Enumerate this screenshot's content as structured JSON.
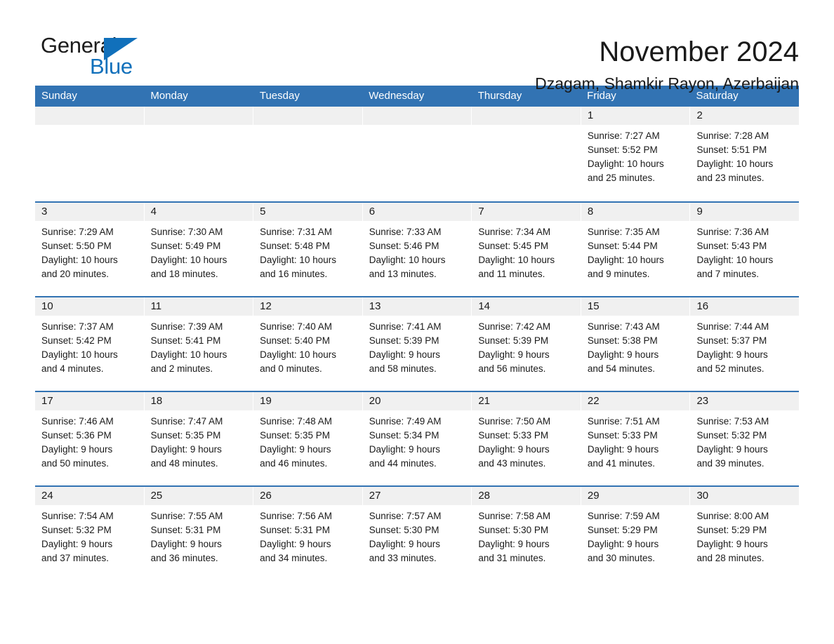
{
  "logo": {
    "word_general": "General",
    "word_blue": "Blue",
    "triangle_color": "#1170bb"
  },
  "header": {
    "title": "November 2024",
    "subtitle": "Dzagam, Shamkir Rayon, Azerbaijan"
  },
  "theme": {
    "accent": "#3273b3",
    "daynum_bg": "#f0f0f0",
    "text": "#1a1a1a",
    "header_text": "#ffffff"
  },
  "weekdays": [
    "Sunday",
    "Monday",
    "Tuesday",
    "Wednesday",
    "Thursday",
    "Friday",
    "Saturday"
  ],
  "labels": {
    "sunrise_prefix": "Sunrise:",
    "sunset_prefix": "Sunset:",
    "daylight_prefix": "Daylight:"
  },
  "weeks": [
    [
      {
        "empty": true
      },
      {
        "empty": true
      },
      {
        "empty": true
      },
      {
        "empty": true
      },
      {
        "empty": true
      },
      {
        "day": "1",
        "sunrise": "Sunrise: 7:27 AM",
        "sunset": "Sunset: 5:52 PM",
        "daylight_l1": "Daylight: 10 hours",
        "daylight_l2": "and 25 minutes."
      },
      {
        "day": "2",
        "sunrise": "Sunrise: 7:28 AM",
        "sunset": "Sunset: 5:51 PM",
        "daylight_l1": "Daylight: 10 hours",
        "daylight_l2": "and 23 minutes."
      }
    ],
    [
      {
        "day": "3",
        "sunrise": "Sunrise: 7:29 AM",
        "sunset": "Sunset: 5:50 PM",
        "daylight_l1": "Daylight: 10 hours",
        "daylight_l2": "and 20 minutes."
      },
      {
        "day": "4",
        "sunrise": "Sunrise: 7:30 AM",
        "sunset": "Sunset: 5:49 PM",
        "daylight_l1": "Daylight: 10 hours",
        "daylight_l2": "and 18 minutes."
      },
      {
        "day": "5",
        "sunrise": "Sunrise: 7:31 AM",
        "sunset": "Sunset: 5:48 PM",
        "daylight_l1": "Daylight: 10 hours",
        "daylight_l2": "and 16 minutes."
      },
      {
        "day": "6",
        "sunrise": "Sunrise: 7:33 AM",
        "sunset": "Sunset: 5:46 PM",
        "daylight_l1": "Daylight: 10 hours",
        "daylight_l2": "and 13 minutes."
      },
      {
        "day": "7",
        "sunrise": "Sunrise: 7:34 AM",
        "sunset": "Sunset: 5:45 PM",
        "daylight_l1": "Daylight: 10 hours",
        "daylight_l2": "and 11 minutes."
      },
      {
        "day": "8",
        "sunrise": "Sunrise: 7:35 AM",
        "sunset": "Sunset: 5:44 PM",
        "daylight_l1": "Daylight: 10 hours",
        "daylight_l2": "and 9 minutes."
      },
      {
        "day": "9",
        "sunrise": "Sunrise: 7:36 AM",
        "sunset": "Sunset: 5:43 PM",
        "daylight_l1": "Daylight: 10 hours",
        "daylight_l2": "and 7 minutes."
      }
    ],
    [
      {
        "day": "10",
        "sunrise": "Sunrise: 7:37 AM",
        "sunset": "Sunset: 5:42 PM",
        "daylight_l1": "Daylight: 10 hours",
        "daylight_l2": "and 4 minutes."
      },
      {
        "day": "11",
        "sunrise": "Sunrise: 7:39 AM",
        "sunset": "Sunset: 5:41 PM",
        "daylight_l1": "Daylight: 10 hours",
        "daylight_l2": "and 2 minutes."
      },
      {
        "day": "12",
        "sunrise": "Sunrise: 7:40 AM",
        "sunset": "Sunset: 5:40 PM",
        "daylight_l1": "Daylight: 10 hours",
        "daylight_l2": "and 0 minutes."
      },
      {
        "day": "13",
        "sunrise": "Sunrise: 7:41 AM",
        "sunset": "Sunset: 5:39 PM",
        "daylight_l1": "Daylight: 9 hours",
        "daylight_l2": "and 58 minutes."
      },
      {
        "day": "14",
        "sunrise": "Sunrise: 7:42 AM",
        "sunset": "Sunset: 5:39 PM",
        "daylight_l1": "Daylight: 9 hours",
        "daylight_l2": "and 56 minutes."
      },
      {
        "day": "15",
        "sunrise": "Sunrise: 7:43 AM",
        "sunset": "Sunset: 5:38 PM",
        "daylight_l1": "Daylight: 9 hours",
        "daylight_l2": "and 54 minutes."
      },
      {
        "day": "16",
        "sunrise": "Sunrise: 7:44 AM",
        "sunset": "Sunset: 5:37 PM",
        "daylight_l1": "Daylight: 9 hours",
        "daylight_l2": "and 52 minutes."
      }
    ],
    [
      {
        "day": "17",
        "sunrise": "Sunrise: 7:46 AM",
        "sunset": "Sunset: 5:36 PM",
        "daylight_l1": "Daylight: 9 hours",
        "daylight_l2": "and 50 minutes."
      },
      {
        "day": "18",
        "sunrise": "Sunrise: 7:47 AM",
        "sunset": "Sunset: 5:35 PM",
        "daylight_l1": "Daylight: 9 hours",
        "daylight_l2": "and 48 minutes."
      },
      {
        "day": "19",
        "sunrise": "Sunrise: 7:48 AM",
        "sunset": "Sunset: 5:35 PM",
        "daylight_l1": "Daylight: 9 hours",
        "daylight_l2": "and 46 minutes."
      },
      {
        "day": "20",
        "sunrise": "Sunrise: 7:49 AM",
        "sunset": "Sunset: 5:34 PM",
        "daylight_l1": "Daylight: 9 hours",
        "daylight_l2": "and 44 minutes."
      },
      {
        "day": "21",
        "sunrise": "Sunrise: 7:50 AM",
        "sunset": "Sunset: 5:33 PM",
        "daylight_l1": "Daylight: 9 hours",
        "daylight_l2": "and 43 minutes."
      },
      {
        "day": "22",
        "sunrise": "Sunrise: 7:51 AM",
        "sunset": "Sunset: 5:33 PM",
        "daylight_l1": "Daylight: 9 hours",
        "daylight_l2": "and 41 minutes."
      },
      {
        "day": "23",
        "sunrise": "Sunrise: 7:53 AM",
        "sunset": "Sunset: 5:32 PM",
        "daylight_l1": "Daylight: 9 hours",
        "daylight_l2": "and 39 minutes."
      }
    ],
    [
      {
        "day": "24",
        "sunrise": "Sunrise: 7:54 AM",
        "sunset": "Sunset: 5:32 PM",
        "daylight_l1": "Daylight: 9 hours",
        "daylight_l2": "and 37 minutes."
      },
      {
        "day": "25",
        "sunrise": "Sunrise: 7:55 AM",
        "sunset": "Sunset: 5:31 PM",
        "daylight_l1": "Daylight: 9 hours",
        "daylight_l2": "and 36 minutes."
      },
      {
        "day": "26",
        "sunrise": "Sunrise: 7:56 AM",
        "sunset": "Sunset: 5:31 PM",
        "daylight_l1": "Daylight: 9 hours",
        "daylight_l2": "and 34 minutes."
      },
      {
        "day": "27",
        "sunrise": "Sunrise: 7:57 AM",
        "sunset": "Sunset: 5:30 PM",
        "daylight_l1": "Daylight: 9 hours",
        "daylight_l2": "and 33 minutes."
      },
      {
        "day": "28",
        "sunrise": "Sunrise: 7:58 AM",
        "sunset": "Sunset: 5:30 PM",
        "daylight_l1": "Daylight: 9 hours",
        "daylight_l2": "and 31 minutes."
      },
      {
        "day": "29",
        "sunrise": "Sunrise: 7:59 AM",
        "sunset": "Sunset: 5:29 PM",
        "daylight_l1": "Daylight: 9 hours",
        "daylight_l2": "and 30 minutes."
      },
      {
        "day": "30",
        "sunrise": "Sunrise: 8:00 AM",
        "sunset": "Sunset: 5:29 PM",
        "daylight_l1": "Daylight: 9 hours",
        "daylight_l2": "and 28 minutes."
      }
    ]
  ]
}
